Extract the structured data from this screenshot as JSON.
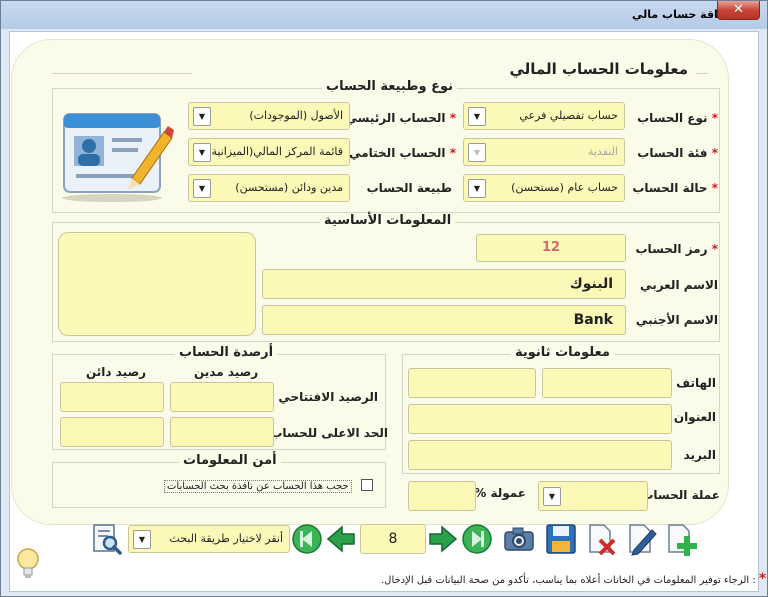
{
  "window": {
    "title": "بطاقة حساب مالي",
    "close_label": "✕"
  },
  "page_title": "معلومات الحساب المالي",
  "type_group": {
    "title": "نوع وطبيعة الحساب",
    "account_type": {
      "label": "نوع الحساب",
      "value": "حساب تفصيلي فرعي"
    },
    "main_account": {
      "label": "الحساب الرئيسي",
      "value": "الأصول (الموجودات)"
    },
    "account_category": {
      "label": "فئة الحساب",
      "value": "النقدية"
    },
    "final_account": {
      "label": "الحساب الختامي",
      "value": "قائمة المركز المالي(الميزانية)"
    },
    "account_status": {
      "label": "حالة الحساب",
      "value": "حساب عام (مستحسن)"
    },
    "account_nature": {
      "label": "طبيعة الحساب",
      "value": "مدين ودائن (مستحسن)"
    }
  },
  "basic_group": {
    "title": "المعلومات الأساسية",
    "code": {
      "label": "رمز الحساب",
      "value": "12"
    },
    "arabic_name": {
      "label": "الاسم العربي",
      "value": "البنوك"
    },
    "foreign_name": {
      "label": "الاسم الأجنبي",
      "value": "Bank"
    }
  },
  "balances_group": {
    "title": "أرصدة الحساب",
    "debit_header": "رصيد مدين",
    "credit_header": "رصيد دائن",
    "opening_label": "الرصيد الافتتاحي",
    "max_label": "الحد الاعلى للحساب"
  },
  "secondary_group": {
    "title": "معلومات ثانوية",
    "phone_label": "الهاتف",
    "address_label": "العنوان",
    "email_label": "البريد"
  },
  "security_group": {
    "title": "أمن المعلومات",
    "hide_label": "حجب هذا الحساب عن نافذة بحث الحسابات"
  },
  "currency": {
    "label": "عملة الحساب",
    "value": ""
  },
  "commission": {
    "label": "عمولة %",
    "value": ""
  },
  "navigation": {
    "record_number": "8",
    "search_method": "أنقر لاختيار طريقة البحث"
  },
  "footer_note": "الرجاء توفير المعلومات في الخانات أعلاه بما يناسب، تأكدو من صحة البيانات قبل الإدخال.",
  "required_mark": "*",
  "colors": {
    "field_bg": "#fbf8b8",
    "panel_bg": "#fbfbea",
    "required": "#d02020",
    "nav_green": "#2aa24a",
    "add_green": "#2fb34a",
    "delete_red": "#d22a2a"
  },
  "icons": [
    "id-card-icon",
    "add-icon",
    "edit-icon",
    "delete-icon",
    "save-icon",
    "camera-icon",
    "first-icon",
    "prev-icon",
    "next-icon",
    "last-icon",
    "search-icon",
    "lightbulb-icon"
  ]
}
